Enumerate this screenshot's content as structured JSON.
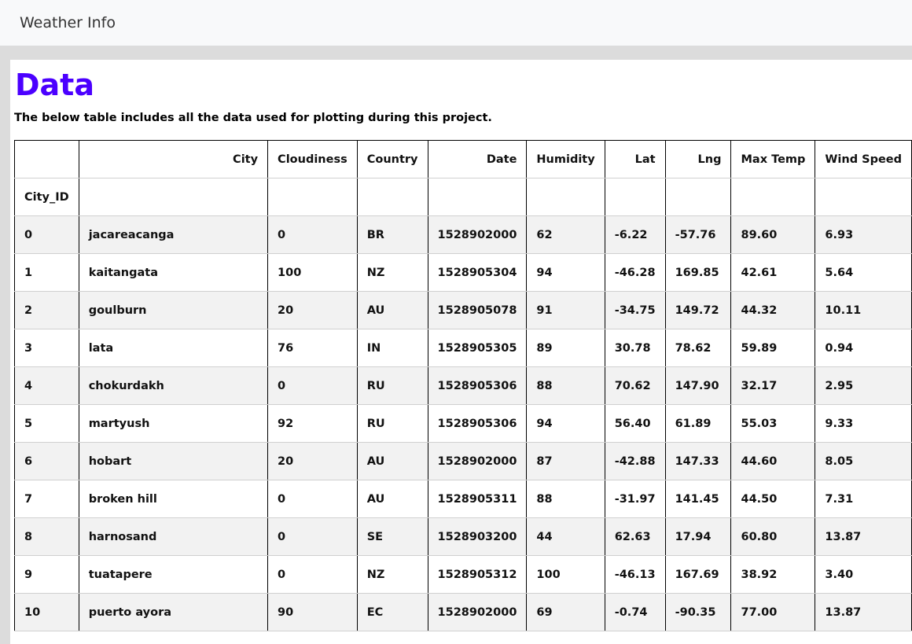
{
  "navbar": {
    "brand": "Weather Info"
  },
  "main": {
    "title": "Data",
    "description": "The below table includes all the data used for plotting during this project."
  },
  "colors": {
    "accent": "#4b00ff",
    "row_stripe": "#f2f2f2"
  },
  "table": {
    "columns": [
      "",
      "City",
      "Cloudiness",
      "Country",
      "Date",
      "Humidity",
      "Lat",
      "Lng",
      "Max Temp",
      "Wind Speed"
    ],
    "index_name": "City_ID",
    "rows": [
      [
        "0",
        "jacareacanga",
        "0",
        "BR",
        "1528902000",
        "62",
        "-6.22",
        "-57.76",
        "89.60",
        "6.93"
      ],
      [
        "1",
        "kaitangata",
        "100",
        "NZ",
        "1528905304",
        "94",
        "-46.28",
        "169.85",
        "42.61",
        "5.64"
      ],
      [
        "2",
        "goulburn",
        "20",
        "AU",
        "1528905078",
        "91",
        "-34.75",
        "149.72",
        "44.32",
        "10.11"
      ],
      [
        "3",
        "lata",
        "76",
        "IN",
        "1528905305",
        "89",
        "30.78",
        "78.62",
        "59.89",
        "0.94"
      ],
      [
        "4",
        "chokurdakh",
        "0",
        "RU",
        "1528905306",
        "88",
        "70.62",
        "147.90",
        "32.17",
        "2.95"
      ],
      [
        "5",
        "martyush",
        "92",
        "RU",
        "1528905306",
        "94",
        "56.40",
        "61.89",
        "55.03",
        "9.33"
      ],
      [
        "6",
        "hobart",
        "20",
        "AU",
        "1528902000",
        "87",
        "-42.88",
        "147.33",
        "44.60",
        "8.05"
      ],
      [
        "7",
        "broken hill",
        "0",
        "AU",
        "1528905311",
        "88",
        "-31.97",
        "141.45",
        "44.50",
        "7.31"
      ],
      [
        "8",
        "harnosand",
        "0",
        "SE",
        "1528903200",
        "44",
        "62.63",
        "17.94",
        "60.80",
        "13.87"
      ],
      [
        "9",
        "tuatapere",
        "0",
        "NZ",
        "1528905312",
        "100",
        "-46.13",
        "167.69",
        "38.92",
        "3.40"
      ],
      [
        "10",
        "puerto ayora",
        "90",
        "EC",
        "1528902000",
        "69",
        "-0.74",
        "-90.35",
        "77.00",
        "13.87"
      ]
    ]
  }
}
